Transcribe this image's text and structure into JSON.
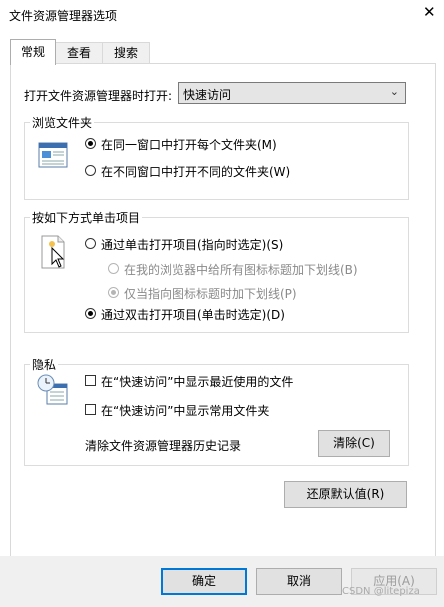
{
  "window": {
    "title": "文件资源管理器选项",
    "close_symbol": "✕"
  },
  "tabs": [
    {
      "label": "常规",
      "active": true
    },
    {
      "label": "查看",
      "active": false
    },
    {
      "label": "搜索",
      "active": false
    }
  ],
  "open_to": {
    "label": "打开文件资源管理器时打开:",
    "value": "快速访问"
  },
  "browse_folders": {
    "title": "浏览文件夹",
    "options": [
      {
        "label": "在同一窗口中打开每个文件夹(M)",
        "selected": true
      },
      {
        "label": "在不同窗口中打开不同的文件夹(W)",
        "selected": false
      }
    ]
  },
  "click_items": {
    "title": "按如下方式单击项目",
    "single_click": {
      "label": "通过单击打开项目(指向时选定)(S)",
      "selected": false
    },
    "underline_all": {
      "label": "在我的浏览器中给所有图标标题加下划线(B)",
      "selected": false,
      "disabled": true
    },
    "underline_point": {
      "label": "仅当指向图标标题时加下划线(P)",
      "selected": true,
      "disabled": true
    },
    "double_click": {
      "label": "通过双击打开项目(单击时选定)(D)",
      "selected": true
    }
  },
  "privacy": {
    "title": "隐私",
    "show_recent": {
      "label": "在“快速访问”中显示最近使用的文件",
      "checked": false
    },
    "show_frequent": {
      "label": "在“快速访问”中显示常用文件夹",
      "checked": false
    },
    "clear_label": "清除文件资源管理器历史记录",
    "clear_button": "清除(C)"
  },
  "restore_defaults_button": "还原默认值(R)",
  "footer": {
    "ok": "确定",
    "cancel": "取消",
    "apply": "应用(A)"
  },
  "watermark": "CSDN @litepiza"
}
